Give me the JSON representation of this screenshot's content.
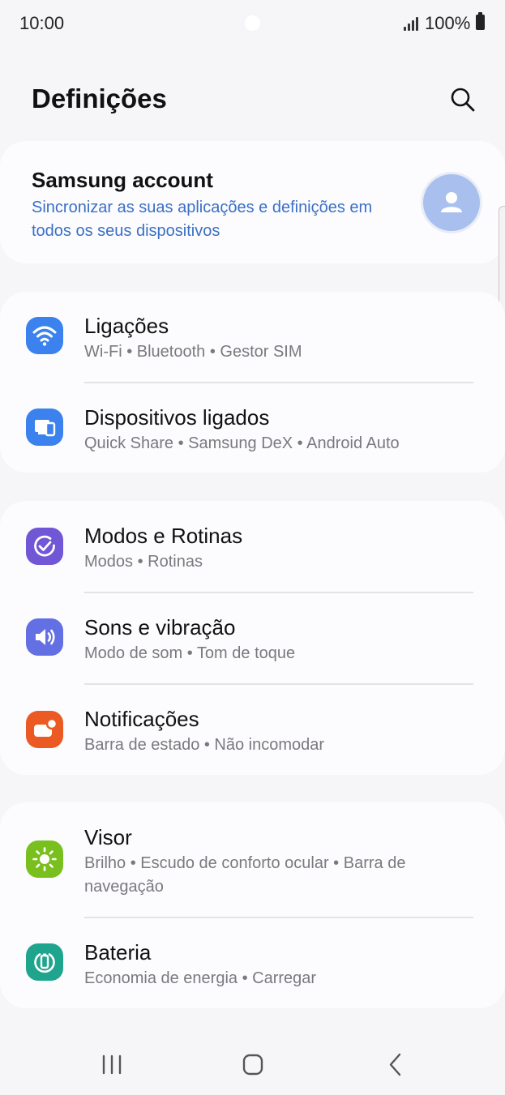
{
  "status_bar": {
    "time": "10:00",
    "battery": "100%"
  },
  "header": {
    "title": "Definições",
    "search_icon": "search-icon"
  },
  "account": {
    "title": "Samsung account",
    "subtitle": "Sincronizar as suas aplicações e definições em todos os seus dispositivos",
    "accent_color": "#3b6fc4",
    "avatar_icon": "person-icon"
  },
  "groups": [
    {
      "items": [
        {
          "label": "Ligações",
          "sub": "Wi-Fi  •  Bluetooth  •  Gestor SIM",
          "icon": "wifi-icon",
          "color": "#3b82ef"
        },
        {
          "label": "Dispositivos ligados",
          "sub": "Quick Share  •  Samsung DeX  •  Android Auto",
          "icon": "connected-devices-icon",
          "color": "#3b82ef"
        }
      ]
    },
    {
      "items": [
        {
          "label": "Modos e Rotinas",
          "sub": "Modos  •  Rotinas",
          "icon": "modes-routines-icon",
          "color": "#7156d6"
        },
        {
          "label": "Sons e vibração",
          "sub": "Modo de som  •  Tom de toque",
          "icon": "volume-icon",
          "color": "#6370e4"
        },
        {
          "label": "Notificações",
          "sub": "Barra de estado  •  Não incomodar",
          "icon": "notification-icon",
          "color": "#ea5a22"
        }
      ]
    },
    {
      "items": [
        {
          "label": "Visor",
          "sub": "Brilho  •  Escudo de conforto ocular  •  Barra de navegação",
          "icon": "brightness-icon",
          "color": "#79c01f"
        },
        {
          "label": "Bateria",
          "sub": "Economia de energia  •  Carregar",
          "icon": "battery-icon",
          "color": "#1fa58e"
        }
      ]
    }
  ],
  "nav_bar": {
    "recents_icon": "recents-icon",
    "home_icon": "home-icon",
    "back_icon": "back-icon"
  }
}
